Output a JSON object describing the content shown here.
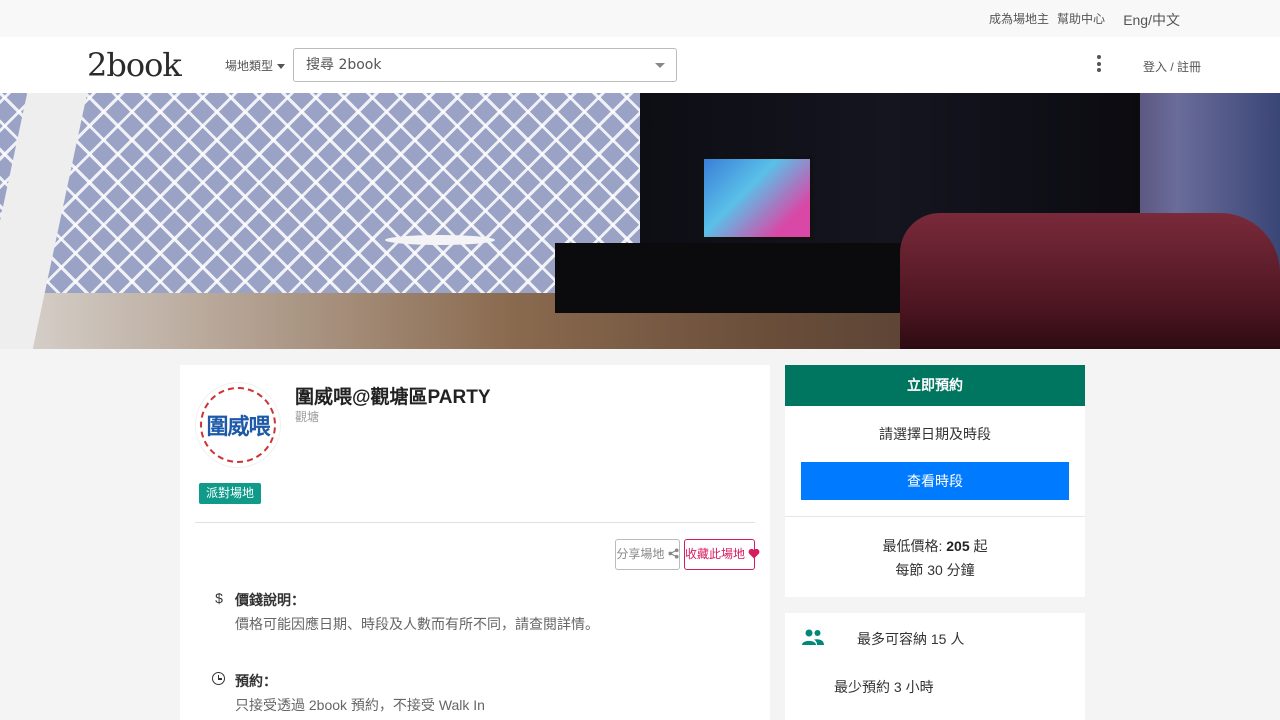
{
  "topbar": {
    "link1": "成為場地主",
    "link2": "幫助中心",
    "lang": "Eng/中文"
  },
  "nav": {
    "logo": "2book",
    "venue_type": "場地類型",
    "search_placeholder": "搜尋 2book",
    "login": "登入 / 註冊"
  },
  "venue": {
    "logo_text": "圍威喂",
    "name": "圍威喂@觀塘區PARTY",
    "district": "觀塘",
    "tag": "派對場地",
    "share_label": "分享場地",
    "fav_label": "收藏此場地",
    "info": [
      {
        "icon": "dollar-icon",
        "title": "價錢說明：",
        "text": "價格可能因應日期、時段及人數而有所不同，請查閱詳情。"
      },
      {
        "icon": "clock-icon",
        "title": "預約：",
        "text": "只接受透過 2book 預約，不接受 Walk In"
      }
    ]
  },
  "booking": {
    "header": "立即預約",
    "prompt": "請選擇日期及時段",
    "button": "查看時段",
    "price_prefix": "最低價格:",
    "price_value": "205",
    "price_suffix": "起",
    "min_booking": "每節 30 分鐘",
    "capacity": "最多可容納 15 人",
    "min_hours": "最少預約 3 小時"
  },
  "colors": {
    "panel_header": "#00755f",
    "book_button": "#007bff",
    "tag": "#0f9a8a",
    "favorite": "#d81b60"
  }
}
